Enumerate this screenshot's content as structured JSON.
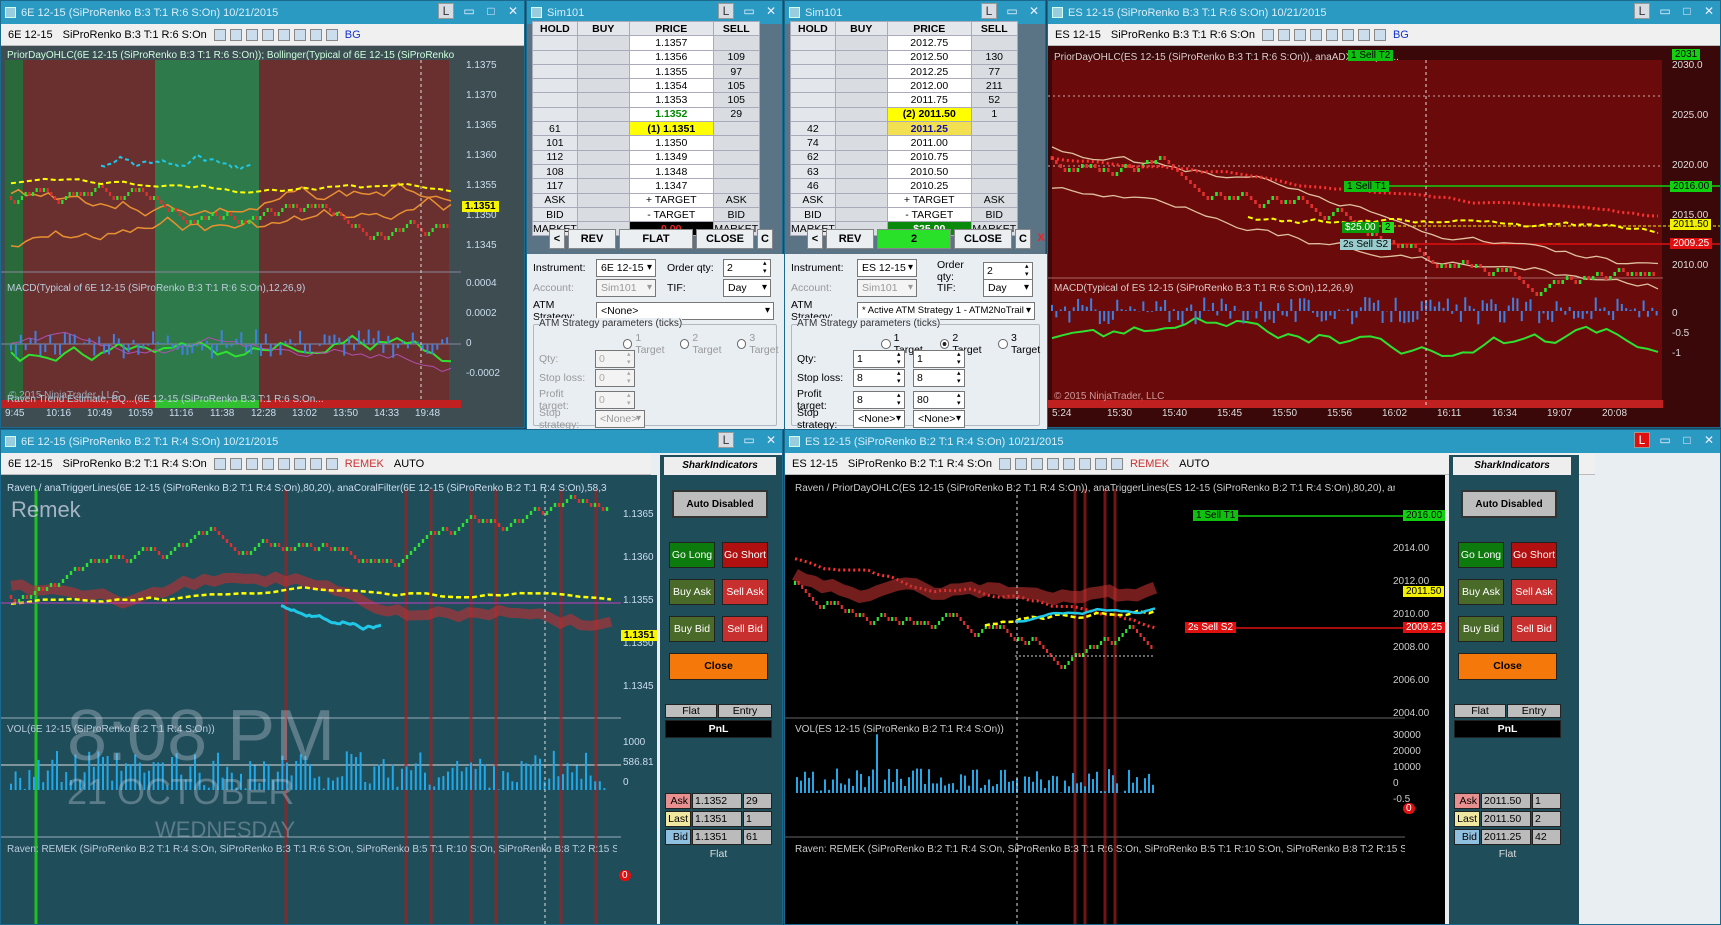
{
  "colors": {
    "titlebar": "#2a9ac2",
    "chart_bg_green": "#2f6f5a",
    "chart_bg_dark": "#3a4a4f",
    "red": "#c81e1e",
    "green": "#28c828",
    "yellow": "#f0f000",
    "cyan": "#20c8e8",
    "orange": "#e89030",
    "black": "#000000"
  },
  "w1": {
    "title": "6E 12-15 (SiProRenko B:3 T:1 R:6 S:On)  10/21/2015",
    "toolbar": {
      "instrument": "6E 12-15",
      "period": "SiProRenko B:3 T:1 R:6 S:On",
      "bg": "BG"
    },
    "ind1": "PriorDayOHLC(6E 12-15 (SiProRenko B:3 T:1 R:6 S:On)); Bollinger(Typical of 6E 12-15 (SiProRenko B:3 T:1 R...",
    "ind2": "MACD(Typical of 6E 12-15 (SiProRenko B:3 T:1 R:6 S:On),12,26,9)",
    "ind3": "Raven Trend Estimate, BQ...(6E 12-15 (SiProRenko B:3 T:1 R:6 S:On...",
    "watermark": "© 2015 NinjaTrader, LLC",
    "price_ticks": [
      "1.1375",
      "1.1370",
      "1.1365",
      "1.1360",
      "1.1355",
      "1.1350",
      "1.1345"
    ],
    "last_price": "1.1351",
    "macd_ticks": [
      "0.0004",
      "0.0002",
      "0",
      "-0.0002"
    ],
    "time_ticks": [
      "9:45",
      "10:16",
      "10:49",
      "10:59",
      "11:16",
      "11:38",
      "12:28",
      "13:02",
      "13:50",
      "14:33",
      "19:48"
    ]
  },
  "dom1": {
    "title": "Sim101",
    "headers": [
      "HOLD",
      "BUY",
      "PRICE",
      "SELL"
    ],
    "rows": [
      {
        "hold": "",
        "buy": "",
        "price": "1.1357",
        "sell": ""
      },
      {
        "hold": "",
        "buy": "",
        "price": "1.1356",
        "sell": "109"
      },
      {
        "hold": "",
        "buy": "",
        "price": "1.1355",
        "sell": "97"
      },
      {
        "hold": "",
        "buy": "",
        "price": "1.1354",
        "sell": "105"
      },
      {
        "hold": "",
        "buy": "",
        "price": "1.1353",
        "sell": "105"
      },
      {
        "hold": "",
        "buy": "",
        "price": "1.1352",
        "sell": "29"
      },
      {
        "hold": "61",
        "buy": "",
        "price": "(1) 1.1351",
        "sell": ""
      },
      {
        "hold": "101",
        "buy": "",
        "price": "1.1350",
        "sell": ""
      },
      {
        "hold": "112",
        "buy": "",
        "price": "1.1349",
        "sell": ""
      },
      {
        "hold": "108",
        "buy": "",
        "price": "1.1348",
        "sell": ""
      },
      {
        "hold": "117",
        "buy": "",
        "price": "1.1347",
        "sell": ""
      },
      {
        "hold": "ASK",
        "buy": "",
        "price": "+ TARGET",
        "sell": "ASK"
      },
      {
        "hold": "BID",
        "buy": "",
        "price": "- TARGET",
        "sell": "BID"
      },
      {
        "hold": "MARKET",
        "buy": "",
        "price": "0.00",
        "sell": "MARKET"
      }
    ],
    "btn_lt": "<",
    "btn_rev": "REV",
    "btn_mid": "FLAT",
    "btn_close": "CLOSE",
    "btn_c": "C",
    "instrument_label": "Instrument:",
    "instrument": "6E 12-15",
    "orderqty_label": "Order qty:",
    "orderqty": "2",
    "account_label": "Account:",
    "account": "Sim101",
    "tif_label": "TIF:",
    "tif": "Day",
    "atm_label": "ATM Strategy:",
    "atm": "<None>",
    "params_label": "ATM Strategy parameters (ticks)",
    "t1": "1 Target",
    "t2": "2 Target",
    "t3": "3 Target",
    "qty_label": "Qty:",
    "qty1": "0",
    "stop_label": "Stop loss:",
    "stop1": "0",
    "pt_label": "Profit target:",
    "pt1": "0",
    "ss_label": "Stop strategy:",
    "ss1": "<None>"
  },
  "dom2": {
    "title": "Sim101",
    "headers": [
      "HOLD",
      "BUY",
      "PRICE",
      "SELL"
    ],
    "rows": [
      {
        "hold": "",
        "buy": "",
        "price": "2012.75",
        "sell": ""
      },
      {
        "hold": "",
        "buy": "",
        "price": "2012.50",
        "sell": "130"
      },
      {
        "hold": "",
        "buy": "",
        "price": "2012.25",
        "sell": "77"
      },
      {
        "hold": "",
        "buy": "",
        "price": "2012.00",
        "sell": "211"
      },
      {
        "hold": "",
        "buy": "",
        "price": "2011.75",
        "sell": "52"
      },
      {
        "hold": "",
        "buy": "",
        "price": "(2) 2011.50",
        "sell": "1"
      },
      {
        "hold": "42",
        "buy": "",
        "price": "2011.25",
        "sell": ""
      },
      {
        "hold": "74",
        "buy": "",
        "price": "2011.00",
        "sell": ""
      },
      {
        "hold": "62",
        "buy": "",
        "price": "2010.75",
        "sell": ""
      },
      {
        "hold": "63",
        "buy": "",
        "price": "2010.50",
        "sell": ""
      },
      {
        "hold": "46",
        "buy": "",
        "price": "2010.25",
        "sell": ""
      },
      {
        "hold": "ASK",
        "buy": "",
        "price": "+ TARGET",
        "sell": "ASK"
      },
      {
        "hold": "BID",
        "buy": "",
        "price": "- TARGET",
        "sell": "BID"
      },
      {
        "hold": "MARKET",
        "buy": "",
        "price": "$25.00",
        "sell": "MARKET"
      }
    ],
    "btn_lt": "<",
    "btn_rev": "REV",
    "btn_mid": "2",
    "btn_close": "CLOSE",
    "btn_c": "C",
    "btn_x": "X",
    "instrument_label": "Instrument:",
    "instrument": "ES 12-15",
    "orderqty_label": "Order qty:",
    "orderqty": "2",
    "account_label": "Account:",
    "account": "Sim101",
    "tif_label": "TIF:",
    "tif": "Day",
    "atm_label": "ATM Strategy:",
    "atm": "* Active ATM Strategy 1 - ATM2NoTrail",
    "params_label": "ATM Strategy parameters (ticks)",
    "t1": "1 Target",
    "t2": "2 Target",
    "t3": "3 Target",
    "qty_label": "Qty:",
    "qty1": "1",
    "qty2": "1",
    "stop_label": "Stop loss:",
    "stop1": "8",
    "stop2": "8",
    "pt_label": "Profit target:",
    "pt1": "8",
    "pt2": "80",
    "ss_label": "Stop strategy:",
    "ss1": "<None>",
    "ss2": "<None>"
  },
  "w4": {
    "title": "ES 12-15 (SiProRenko B:3 T:1 R:6 S:On)  10/21/2015",
    "toolbar": {
      "instrument": "ES 12-15",
      "period": "SiProRenko B:3 T:1 R:6 S:On",
      "bg": "BG"
    },
    "ind1": "PriorDayOHLC(ES 12-15 (SiProRenko B:3 T:1 R:6 S:On)), anaADXVMA(ES...",
    "ind2": "MACD(Typical of ES 12-15 (SiProRenko B:3 T:1 R:6 S:On),12,26,9)",
    "watermark": "© 2015 NinjaTrader, LLC",
    "price_ticks": [
      "2030.0",
      "2025.00",
      "2020.00",
      "2015.00",
      "2010.00"
    ],
    "macd_ticks": [
      "0",
      "-0.5",
      "-1"
    ],
    "time_ticks": [
      "5:24",
      "15:30",
      "15:40",
      "15:45",
      "15:50",
      "15:56",
      "16:02",
      "16:11",
      "16:34",
      "19:07",
      "20:08"
    ],
    "tag_sell_t1": "1  Sell T1",
    "tag_sell_s2": "2s  Sell S2",
    "tag_t1_price": "2016.00",
    "tag_last": "2011.50",
    "tag_s2_price": "2009.25",
    "tag_top": "2031",
    "tag_top2": "1  Sell T2",
    "pnl_tag": "$25.00",
    "pnl_qty": "2"
  },
  "w5": {
    "title": "6E 12-15 (SiProRenko B:2 T:1 R:4 S:On)  10/21/2015",
    "toolbar": {
      "instrument": "6E 12-15",
      "period": "SiProRenko B:2 T:1 R:4 S:On",
      "remek": "REMEK",
      "auto": "AUTO"
    },
    "ind1": "Raven / anaTriggerLines(6E 12-15 (SiProRenko B:2 T:1 R:4 S:On),80,20), anaCoralFilter(6E 12-15 (SiProRenko B:2 T:1 R:4 S:On),58,30), PriorDayOH...",
    "remek_label": "Remek",
    "vol_label": "VOL(6E 12-15 (SiProRenko B:2 T:1 R:4 S:On))",
    "ind3": "Raven: REMEK (SiProRenko B:2 T:1 R:4 S:On, SiProRenko B:3 T:1 R:6 S:On, SiProRenko B:5 T:1 R:10 S:On, SiProRenko B:8 T:2 R:15 S:On, SiProRe...",
    "price_ticks": [
      "1.1365",
      "1.1360",
      "1.1355",
      "1.1350",
      "1.1345"
    ],
    "last_price": "1.1351",
    "vol_ticks": [
      "1000",
      "586.81",
      "0"
    ],
    "clock_time": "8:08 PM",
    "clock_day": "21 OCTOBER",
    "clock_wd": "WEDNESDAY",
    "alert": "0"
  },
  "shark1": {
    "logo": "SharkIndicators",
    "auto": "Auto Disabled",
    "go_long": "Go Long",
    "go_short": "Go Short",
    "buy_ask": "Buy Ask",
    "sell_ask": "Sell Ask",
    "buy_bid": "Buy Bid",
    "sell_bid": "Sell Bid",
    "close": "Close",
    "flat": "Flat",
    "entry": "Entry",
    "pnl": "PnL",
    "ask_l": "Ask",
    "ask_p": "1.1352",
    "ask_q": "29",
    "last_l": "Last",
    "last_p": "1.1351",
    "last_q": "1",
    "bid_l": "Bid",
    "bid_p": "1.1351",
    "bid_q": "61",
    "status": "Flat"
  },
  "w6": {
    "title": "ES 12-15 (SiProRenko B:2 T:1 R:4 S:On)  10/21/2015",
    "toolbar": {
      "instrument": "ES 12-15",
      "period": "SiProRenko B:2 T:1 R:4 S:On",
      "remek": "REMEK",
      "auto": "AUTO"
    },
    "ind1": "Raven / PriorDayOHLC(ES 12-15 (SiProRenko B:2 T:1 R:4 S:On)), anaTriggerLines(ES 12-15 (SiProRenko B:2 T:1 R:4 S:On),80,20), anaADXVMA(ES...",
    "vol_label": "VOL(ES 12-15 (SiProRenko B:2 T:1 R:4 S:On))",
    "ind3": "Raven: REMEK (SiProRenko B:2 T:1 R:4 S:On, SiProRenko B:3 T:1 R:6 S:On, SiProRenko B:5 T:1 R:10 S:On, SiProRenko B:8 T:2 R:15 S:On, SiProRe...",
    "price_ticks": [
      "2014.00",
      "2012.00",
      "2010.00",
      "2008.00",
      "2006.00",
      "2004.00"
    ],
    "vol_ticks": [
      "30000",
      "20000",
      "10000",
      "0",
      "-0.5"
    ],
    "tag_sell_t1": "1  Sell T1",
    "tag_t1_price": "2016.00",
    "tag_last": "2011.50",
    "tag_sell_s2": "2s  Sell S2",
    "tag_s2_price": "2009.25",
    "alert": "0"
  },
  "shark2": {
    "logo": "SharkIndicators",
    "auto": "Auto Disabled",
    "go_long": "Go Long",
    "go_short": "Go Short",
    "buy_ask": "Buy Ask",
    "sell_ask": "Sell Ask",
    "buy_bid": "Buy Bid",
    "sell_bid": "Sell Bid",
    "close": "Close",
    "flat": "Flat",
    "entry": "Entry",
    "pnl": "PnL",
    "ask_l": "Ask",
    "ask_p": "2011.50",
    "ask_q": "1",
    "last_l": "Last",
    "last_p": "2011.50",
    "last_q": "2",
    "bid_l": "Bid",
    "bid_p": "2011.25",
    "bid_q": "42",
    "status": "Flat"
  }
}
